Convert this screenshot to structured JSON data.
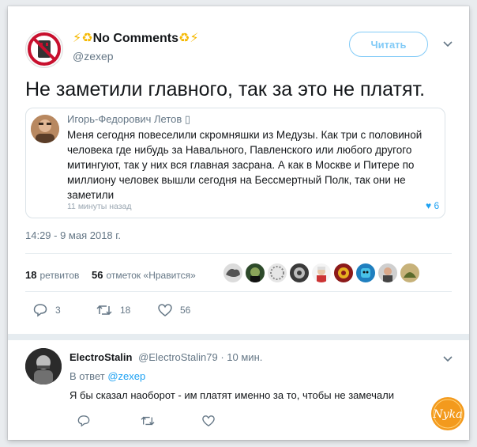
{
  "tweet": {
    "author": {
      "emoji_left": "⚡♻",
      "name": "No Comments",
      "emoji_right": "♻⚡",
      "handle": "@zexep"
    },
    "follow_label": "Читать",
    "text": "Не заметили главного, так за это не платят.",
    "quote": {
      "author_name": "Игорь-Федорович Летов",
      "author_badge": "▯",
      "text": "Меня сегодня повеселили скромняшки из Медузы. Как три с половиной человека где нибудь за Навального, Павленского или любого другого митингуют, так у них вся главная засрана. А как в Москве и Питере по миллиону человек вышли сегодня на Бессмертный Полк, так они не заметили",
      "time": "11 минуты назад",
      "likes": "6"
    },
    "timestamp": "14:29 - 9 мая 2018 г.",
    "stats": {
      "retweets_count": "18",
      "retweets_label": "ретвитов",
      "likes_count": "56",
      "likes_label": "отметок «Нравится»"
    },
    "actions": {
      "reply_count": "3",
      "retweet_count": "18",
      "like_count": "56"
    }
  },
  "reply": {
    "name": "ElectroStalin",
    "handle": "@ElectroStalin79",
    "time": "· 10 мин.",
    "reply_to_prefix": "В ответ",
    "reply_to_handle": "@zexep",
    "text": "Я бы сказал наоборот - им платят именно за то, чтобы не замечали"
  },
  "watermark": {
    "text": "Nyka"
  },
  "colors": {
    "accent": "#1da1f2",
    "text_primary": "#14171a",
    "text_secondary": "#657786",
    "border": "#e6ecf0",
    "watermark_orange": "#f39a1d"
  }
}
